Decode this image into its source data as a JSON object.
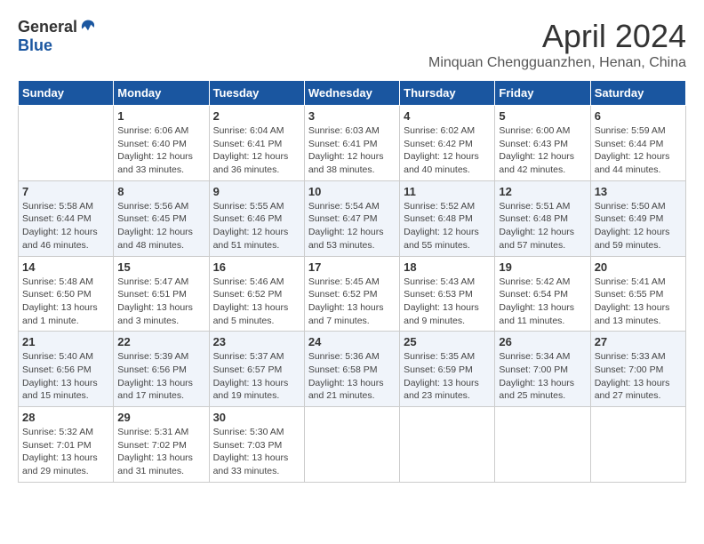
{
  "logo": {
    "general": "General",
    "blue": "Blue"
  },
  "title": "April 2024",
  "location": "Minquan Chengguanzhen, Henan, China",
  "weekdays": [
    "Sunday",
    "Monday",
    "Tuesday",
    "Wednesday",
    "Thursday",
    "Friday",
    "Saturday"
  ],
  "weeks": [
    [
      {
        "day": "",
        "info": ""
      },
      {
        "day": "1",
        "info": "Sunrise: 6:06 AM\nSunset: 6:40 PM\nDaylight: 12 hours\nand 33 minutes."
      },
      {
        "day": "2",
        "info": "Sunrise: 6:04 AM\nSunset: 6:41 PM\nDaylight: 12 hours\nand 36 minutes."
      },
      {
        "day": "3",
        "info": "Sunrise: 6:03 AM\nSunset: 6:41 PM\nDaylight: 12 hours\nand 38 minutes."
      },
      {
        "day": "4",
        "info": "Sunrise: 6:02 AM\nSunset: 6:42 PM\nDaylight: 12 hours\nand 40 minutes."
      },
      {
        "day": "5",
        "info": "Sunrise: 6:00 AM\nSunset: 6:43 PM\nDaylight: 12 hours\nand 42 minutes."
      },
      {
        "day": "6",
        "info": "Sunrise: 5:59 AM\nSunset: 6:44 PM\nDaylight: 12 hours\nand 44 minutes."
      }
    ],
    [
      {
        "day": "7",
        "info": "Sunrise: 5:58 AM\nSunset: 6:44 PM\nDaylight: 12 hours\nand 46 minutes."
      },
      {
        "day": "8",
        "info": "Sunrise: 5:56 AM\nSunset: 6:45 PM\nDaylight: 12 hours\nand 48 minutes."
      },
      {
        "day": "9",
        "info": "Sunrise: 5:55 AM\nSunset: 6:46 PM\nDaylight: 12 hours\nand 51 minutes."
      },
      {
        "day": "10",
        "info": "Sunrise: 5:54 AM\nSunset: 6:47 PM\nDaylight: 12 hours\nand 53 minutes."
      },
      {
        "day": "11",
        "info": "Sunrise: 5:52 AM\nSunset: 6:48 PM\nDaylight: 12 hours\nand 55 minutes."
      },
      {
        "day": "12",
        "info": "Sunrise: 5:51 AM\nSunset: 6:48 PM\nDaylight: 12 hours\nand 57 minutes."
      },
      {
        "day": "13",
        "info": "Sunrise: 5:50 AM\nSunset: 6:49 PM\nDaylight: 12 hours\nand 59 minutes."
      }
    ],
    [
      {
        "day": "14",
        "info": "Sunrise: 5:48 AM\nSunset: 6:50 PM\nDaylight: 13 hours\nand 1 minute."
      },
      {
        "day": "15",
        "info": "Sunrise: 5:47 AM\nSunset: 6:51 PM\nDaylight: 13 hours\nand 3 minutes."
      },
      {
        "day": "16",
        "info": "Sunrise: 5:46 AM\nSunset: 6:52 PM\nDaylight: 13 hours\nand 5 minutes."
      },
      {
        "day": "17",
        "info": "Sunrise: 5:45 AM\nSunset: 6:52 PM\nDaylight: 13 hours\nand 7 minutes."
      },
      {
        "day": "18",
        "info": "Sunrise: 5:43 AM\nSunset: 6:53 PM\nDaylight: 13 hours\nand 9 minutes."
      },
      {
        "day": "19",
        "info": "Sunrise: 5:42 AM\nSunset: 6:54 PM\nDaylight: 13 hours\nand 11 minutes."
      },
      {
        "day": "20",
        "info": "Sunrise: 5:41 AM\nSunset: 6:55 PM\nDaylight: 13 hours\nand 13 minutes."
      }
    ],
    [
      {
        "day": "21",
        "info": "Sunrise: 5:40 AM\nSunset: 6:56 PM\nDaylight: 13 hours\nand 15 minutes."
      },
      {
        "day": "22",
        "info": "Sunrise: 5:39 AM\nSunset: 6:56 PM\nDaylight: 13 hours\nand 17 minutes."
      },
      {
        "day": "23",
        "info": "Sunrise: 5:37 AM\nSunset: 6:57 PM\nDaylight: 13 hours\nand 19 minutes."
      },
      {
        "day": "24",
        "info": "Sunrise: 5:36 AM\nSunset: 6:58 PM\nDaylight: 13 hours\nand 21 minutes."
      },
      {
        "day": "25",
        "info": "Sunrise: 5:35 AM\nSunset: 6:59 PM\nDaylight: 13 hours\nand 23 minutes."
      },
      {
        "day": "26",
        "info": "Sunrise: 5:34 AM\nSunset: 7:00 PM\nDaylight: 13 hours\nand 25 minutes."
      },
      {
        "day": "27",
        "info": "Sunrise: 5:33 AM\nSunset: 7:00 PM\nDaylight: 13 hours\nand 27 minutes."
      }
    ],
    [
      {
        "day": "28",
        "info": "Sunrise: 5:32 AM\nSunset: 7:01 PM\nDaylight: 13 hours\nand 29 minutes."
      },
      {
        "day": "29",
        "info": "Sunrise: 5:31 AM\nSunset: 7:02 PM\nDaylight: 13 hours\nand 31 minutes."
      },
      {
        "day": "30",
        "info": "Sunrise: 5:30 AM\nSunset: 7:03 PM\nDaylight: 13 hours\nand 33 minutes."
      },
      {
        "day": "",
        "info": ""
      },
      {
        "day": "",
        "info": ""
      },
      {
        "day": "",
        "info": ""
      },
      {
        "day": "",
        "info": ""
      }
    ]
  ]
}
